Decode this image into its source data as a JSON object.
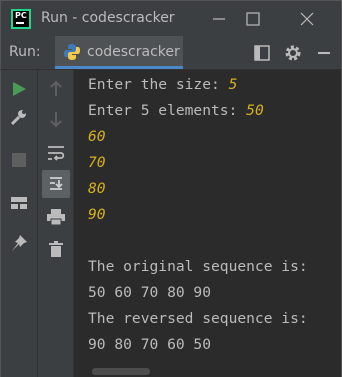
{
  "window": {
    "title": "Run - codescracker",
    "logo_text": "PC"
  },
  "run_panel": {
    "label": "Run:",
    "tab_label": "codescracker"
  },
  "console": {
    "lines": [
      {
        "prefix": "Enter the size: ",
        "input": "5"
      },
      {
        "prefix": "Enter 5 elements: ",
        "input": "50"
      },
      {
        "prefix": "",
        "input": "60"
      },
      {
        "prefix": "",
        "input": "70"
      },
      {
        "prefix": "",
        "input": "80"
      },
      {
        "prefix": "",
        "input": "90"
      },
      {
        "prefix": "",
        "input": ""
      },
      {
        "prefix": "The original sequence is:",
        "input": ""
      },
      {
        "prefix": "50 60 70 80 90",
        "input": ""
      },
      {
        "prefix": "The reversed sequence is:",
        "input": ""
      },
      {
        "prefix": "90 80 70 60 50",
        "input": ""
      }
    ]
  },
  "colors": {
    "accent": "#4a88c7",
    "run_green": "#499c54",
    "user_input": "#d5b21c"
  },
  "icons": {
    "title_bar": [
      "pycharm-logo",
      "minimize-icon",
      "maximize-icon",
      "close-icon"
    ],
    "tab": [
      "python-icon",
      "tab-close-icon",
      "layout-icon",
      "settings-gear-icon",
      "hide-minus-icon"
    ],
    "left_toolbar": [
      "rerun-play-icon",
      "wrench-icon",
      "stop-icon",
      "layout-icon",
      "pin-icon"
    ],
    "console_toolbar": [
      "up-arrow-icon",
      "down-arrow-icon",
      "soft-wrap-icon",
      "scroll-to-end-icon",
      "print-icon",
      "trash-icon"
    ]
  }
}
